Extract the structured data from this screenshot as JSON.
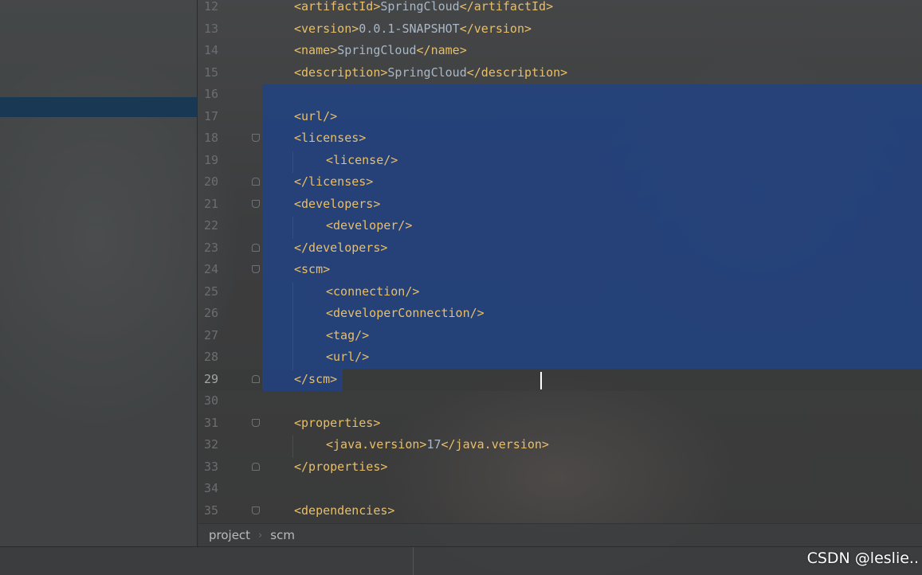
{
  "editor": {
    "current_line": "29",
    "lines": [
      {
        "num": "12",
        "parts": [
          [
            "tag",
            "<artifactId>"
          ],
          [
            "txt",
            "SpringCloud"
          ],
          [
            "tag",
            "</artifactId>"
          ]
        ],
        "indent": 0
      },
      {
        "num": "13",
        "parts": [
          [
            "tag",
            "<version>"
          ],
          [
            "txt",
            "0.0.1-SNAPSHOT"
          ],
          [
            "tag",
            "</version>"
          ]
        ],
        "indent": 0
      },
      {
        "num": "14",
        "parts": [
          [
            "tag",
            "<name>"
          ],
          [
            "txt",
            "SpringCloud"
          ],
          [
            "tag",
            "</name>"
          ]
        ],
        "indent": 0
      },
      {
        "num": "15",
        "parts": [
          [
            "tag",
            "<description>"
          ],
          [
            "txt",
            "SpringCloud"
          ],
          [
            "tag",
            "</description>"
          ]
        ],
        "indent": 0
      },
      {
        "num": "16",
        "parts": [],
        "indent": 0
      },
      {
        "num": "17",
        "parts": [
          [
            "tag",
            "<url/>"
          ]
        ],
        "indent": 0
      },
      {
        "num": "18",
        "parts": [
          [
            "tag",
            "<licenses>"
          ]
        ],
        "indent": 0,
        "fold": "down"
      },
      {
        "num": "19",
        "parts": [
          [
            "tag",
            "<license/>"
          ]
        ],
        "indent": 1
      },
      {
        "num": "20",
        "parts": [
          [
            "tag",
            "</licenses>"
          ]
        ],
        "indent": 0,
        "fold": "up"
      },
      {
        "num": "21",
        "parts": [
          [
            "tag",
            "<developers>"
          ]
        ],
        "indent": 0,
        "fold": "down"
      },
      {
        "num": "22",
        "parts": [
          [
            "tag",
            "<developer/>"
          ]
        ],
        "indent": 1
      },
      {
        "num": "23",
        "parts": [
          [
            "tag",
            "</developers>"
          ]
        ],
        "indent": 0,
        "fold": "up"
      },
      {
        "num": "24",
        "parts": [
          [
            "tag",
            "<scm>"
          ]
        ],
        "indent": 0,
        "fold": "down"
      },
      {
        "num": "25",
        "parts": [
          [
            "tag",
            "<connection/>"
          ]
        ],
        "indent": 1
      },
      {
        "num": "26",
        "parts": [
          [
            "tag",
            "<developerConnection/>"
          ]
        ],
        "indent": 1
      },
      {
        "num": "27",
        "parts": [
          [
            "tag",
            "<tag/>"
          ]
        ],
        "indent": 1
      },
      {
        "num": "28",
        "parts": [
          [
            "tag",
            "<url/>"
          ]
        ],
        "indent": 1
      },
      {
        "num": "29",
        "parts": [
          [
            "tag",
            "</scm>"
          ]
        ],
        "indent": 0,
        "fold": "up"
      },
      {
        "num": "30",
        "parts": [],
        "indent": 0
      },
      {
        "num": "31",
        "parts": [
          [
            "tag",
            "<properties>"
          ]
        ],
        "indent": 0,
        "fold": "down"
      },
      {
        "num": "32",
        "parts": [
          [
            "tag",
            "<java.version>"
          ],
          [
            "txt",
            "17"
          ],
          [
            "tag",
            "</java.version>"
          ]
        ],
        "indent": 1
      },
      {
        "num": "33",
        "parts": [
          [
            "tag",
            "</properties>"
          ]
        ],
        "indent": 0,
        "fold": "up"
      },
      {
        "num": "34",
        "parts": [],
        "indent": 0
      },
      {
        "num": "35",
        "parts": [
          [
            "tag",
            "<dependencies>"
          ]
        ],
        "indent": 0,
        "fold": "down"
      }
    ]
  },
  "breadcrumb": {
    "items": [
      "project",
      "scm"
    ],
    "separator": "›"
  },
  "watermark": "CSDN @leslie..",
  "colors": {
    "tag": "#e8bf6a",
    "text": "#a9b7c6",
    "selection": "#214283",
    "line_number": "#6b6e70"
  }
}
